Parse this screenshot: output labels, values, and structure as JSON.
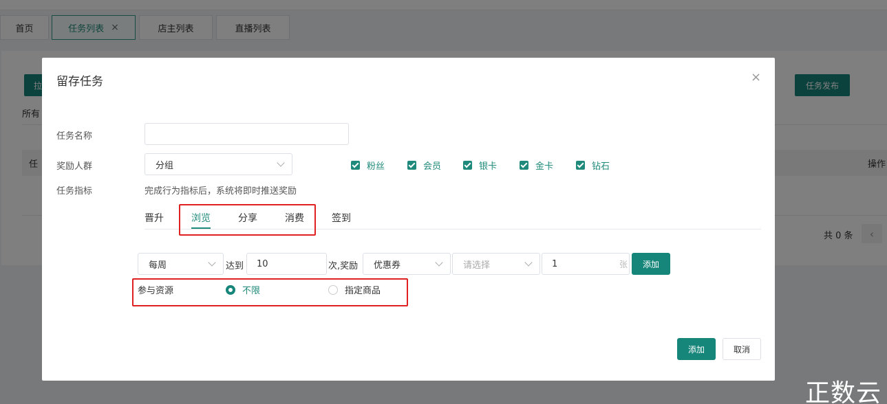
{
  "tabs": [
    {
      "label": "首页"
    },
    {
      "label": "任务列表",
      "close": "×"
    },
    {
      "label": "店主列表"
    },
    {
      "label": "直播列表"
    }
  ],
  "background": {
    "left_button_fragment": "拉",
    "publish_button": "任务发布",
    "all_fragment": "所有",
    "col_task_fragment": "任",
    "col_ops_fragment": "操作",
    "total_text": "共 0 条",
    "prev_icon": "‹"
  },
  "modal": {
    "title": "留存任务",
    "close_icon": "×",
    "fields": {
      "task_name_label": "任务名称",
      "task_name_value": "",
      "reward_group_label": "奖励人群",
      "reward_group_select": "分组",
      "task_index_label": "任务指标",
      "task_index_hint": "完成行为指标后，系统将即时推送奖励"
    },
    "checkboxes": [
      {
        "label": "粉丝",
        "checked": true
      },
      {
        "label": "会员",
        "checked": true
      },
      {
        "label": "银卡",
        "checked": true
      },
      {
        "label": "金卡",
        "checked": true
      },
      {
        "label": "钻石",
        "checked": true
      }
    ],
    "subtabs": [
      {
        "label": "晋升",
        "active": false
      },
      {
        "label": "浏览",
        "active": true
      },
      {
        "label": "分享",
        "active": false
      },
      {
        "label": "消费",
        "active": false
      },
      {
        "label": "签到",
        "active": false
      }
    ],
    "rule": {
      "period": "每周",
      "reach_text": "达到",
      "times_value": "10",
      "times_reward_text": "次,奖励",
      "reward_type": "优惠券",
      "reward_select_placeholder": "请选择",
      "quantity_value": "1",
      "quantity_unit": "张",
      "add_button": "添加"
    },
    "resource": {
      "label": "参与资源",
      "options": [
        {
          "label": "不限",
          "selected": true
        },
        {
          "label": "指定商品",
          "selected": false
        }
      ]
    },
    "footer": {
      "submit": "添加",
      "cancel": "取消"
    }
  },
  "watermark": "正数云",
  "colors": {
    "primary": "#16857a",
    "highlight_box": "#e02020"
  }
}
